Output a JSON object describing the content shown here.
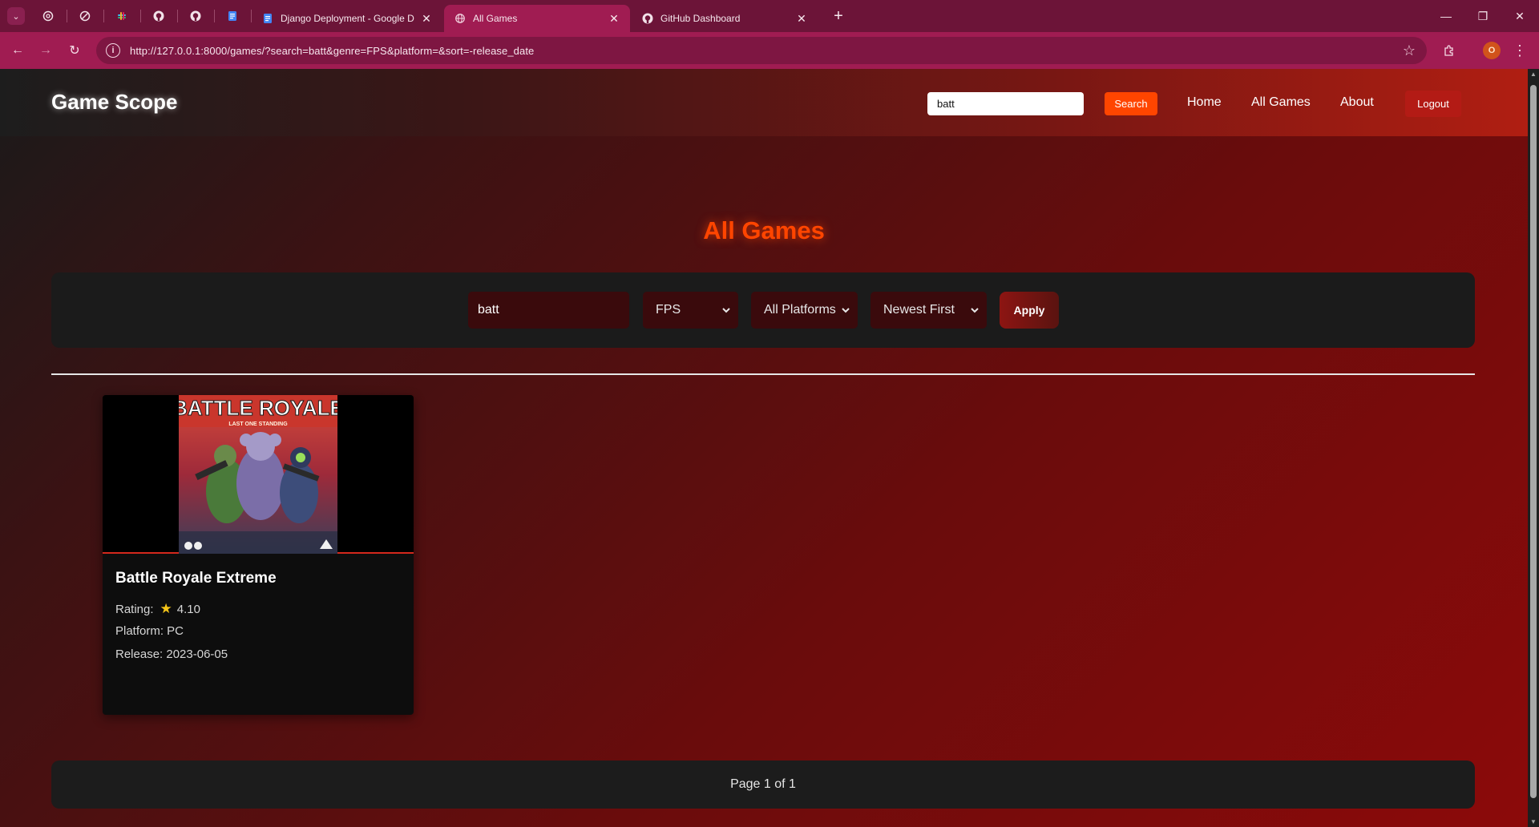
{
  "browser": {
    "tabs": [
      {
        "title": "Django Deployment - Google D",
        "active": false
      },
      {
        "title": "All Games",
        "active": true
      },
      {
        "title": "GitHub Dashboard",
        "active": false
      }
    ],
    "url": "http://127.0.0.1:8000/games/?search=batt&genre=FPS&platform=&sort=-release_date",
    "profile_initial": "O",
    "accent_color": "#a01c52"
  },
  "site": {
    "brand": "Game Scope",
    "header_search_value": "batt",
    "header_search_button": "Search",
    "nav": [
      "Home",
      "All Games",
      "About"
    ],
    "logout_label": "Logout"
  },
  "main": {
    "title": "All Games",
    "filters": {
      "search_value": "batt",
      "genre": "FPS",
      "platform": "All Platforms",
      "sort": "Newest First",
      "apply_label": "Apply"
    },
    "games": [
      {
        "title": "Battle Royale Extreme",
        "cover_title": "BATTLE ROYALE",
        "cover_subtitle": "LAST ONE STANDING",
        "rating_label": "Rating:",
        "rating": "4.10",
        "platform_line": "Platform: PC",
        "release_line": "Release: 2023-06-05"
      }
    ],
    "pagination": "Page 1 of 1"
  },
  "colors": {
    "accent": "#ff4500",
    "card_border": "#d4281c",
    "star": "#f5c518"
  }
}
